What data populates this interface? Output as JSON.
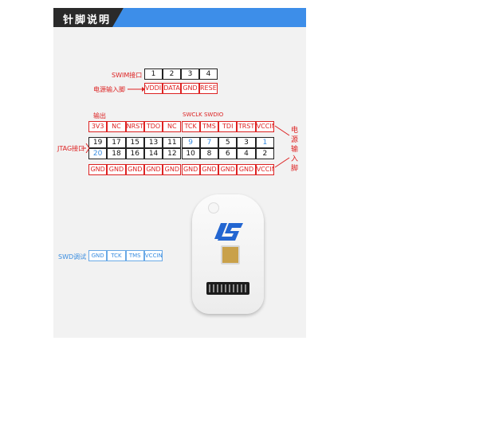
{
  "header": {
    "title": "针脚说明"
  },
  "swim": {
    "title": "SWIM接口",
    "pins": [
      "1",
      "2",
      "3",
      "4"
    ],
    "power_label": "电源输入脚",
    "signals": [
      "VDDIN",
      "DATA",
      "GND",
      "RESET"
    ]
  },
  "jtag": {
    "output_label": "输出",
    "swd_label": "SWCLK SWDIO",
    "top_signals": [
      "3V3",
      "NC",
      "NRST",
      "TDO",
      "NC",
      "TCK",
      "TMS",
      "TDI",
      "TRST",
      "VCCIN"
    ],
    "row_odd": [
      "19",
      "17",
      "15",
      "13",
      "11",
      "9",
      "7",
      "5",
      "3",
      "1"
    ],
    "row_even": [
      "20",
      "18",
      "16",
      "14",
      "12",
      "10",
      "8",
      "6",
      "4",
      "2"
    ],
    "bottom_signals": [
      "GND",
      "GND",
      "GND",
      "GND",
      "GND",
      "GND",
      "GND",
      "GND",
      "GND",
      "VCCIN"
    ],
    "jtag_label": "JTAG接口",
    "power_chars": [
      "电",
      "源",
      "输",
      "入",
      "脚"
    ]
  },
  "swd": {
    "label": "SWD调试",
    "signals": [
      "GND",
      "TCK",
      "TMS",
      "VCCIN"
    ]
  },
  "colors": {
    "red": "#dd2222",
    "blue": "#3a8de0",
    "header_blue": "#3d8ee9",
    "header_dark": "#2a2a2a"
  },
  "device": {
    "logo_text": "LS"
  }
}
